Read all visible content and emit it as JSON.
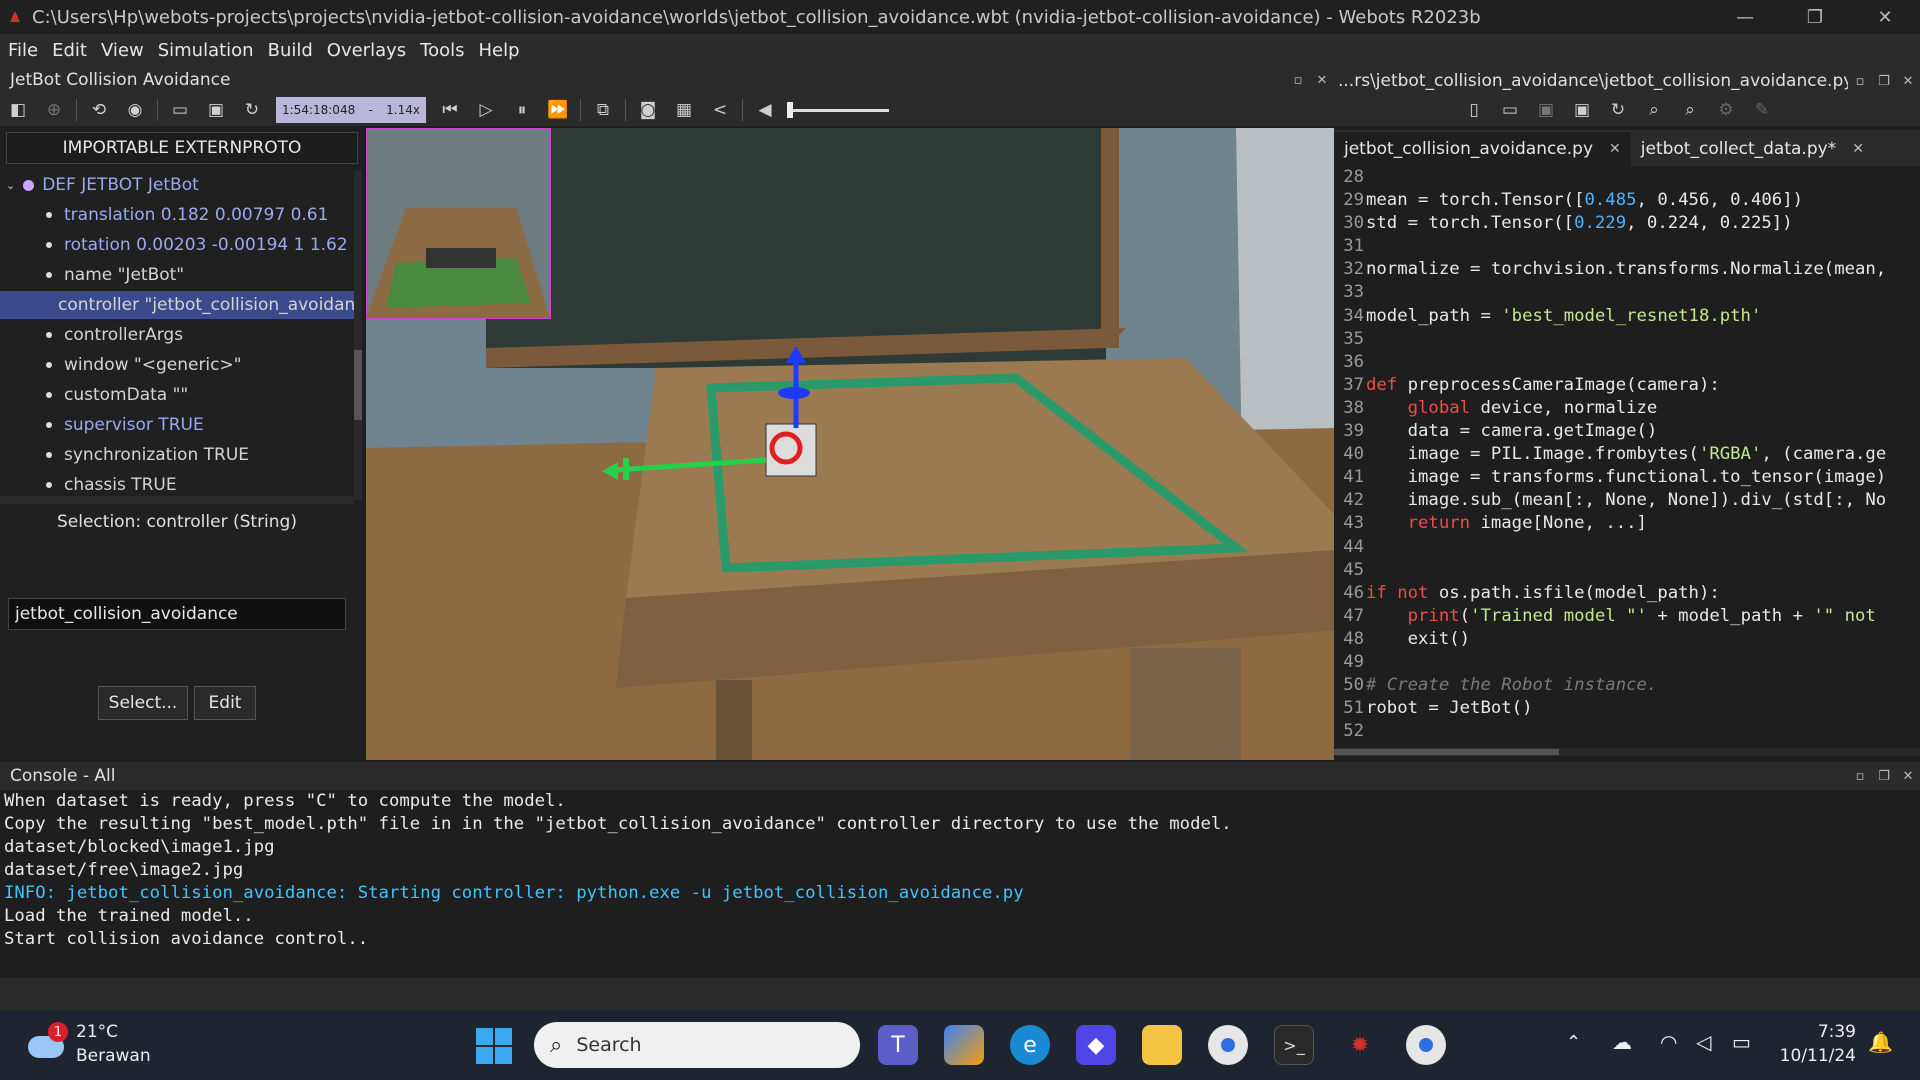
{
  "window": {
    "title": "C:\\Users\\Hp\\webots-projects\\projects\\nvidia-jetbot-collision-avoidance\\worlds\\jetbot_collision_avoidance.wbt (nvidia-jetbot-collision-avoidance) - Webots R2023b",
    "controls": [
      "—",
      "❐",
      "✕"
    ]
  },
  "menu": [
    "File",
    "Edit",
    "View",
    "Simulation",
    "Build",
    "Overlays",
    "Tools",
    "Help"
  ],
  "scene_panel": {
    "title": "JetBot Collision Avoidance",
    "time": "1:54:18:048",
    "speed_sep": "-",
    "speed": "1.14x",
    "importable_btn": "IMPORTABLE EXTERNPROTO",
    "root_node": "DEF JETBOT JetBot",
    "fields": [
      {
        "text": "translation 0.182 0.00797 0.61",
        "modified": true,
        "selected": false
      },
      {
        "text": "rotation 0.00203 -0.00194 1 1.62",
        "modified": true,
        "selected": false
      },
      {
        "text": "name \"JetBot\"",
        "modified": false,
        "selected": false
      },
      {
        "text": "controller \"jetbot_collision_avoidance\"",
        "modified": false,
        "selected": true
      },
      {
        "text": "controllerArgs",
        "modified": false,
        "selected": false
      },
      {
        "text": "window \"<generic>\"",
        "modified": false,
        "selected": false
      },
      {
        "text": "customData \"\"",
        "modified": false,
        "selected": false
      },
      {
        "text": "supervisor TRUE",
        "modified": true,
        "selected": false
      },
      {
        "text": "synchronization TRUE",
        "modified": false,
        "selected": false
      },
      {
        "text": "chassis TRUE",
        "modified": false,
        "selected": false
      }
    ],
    "selection_label": "Selection: controller (String)",
    "controller_value": "jetbot_collision_avoidance",
    "select_btn": "Select...",
    "edit_btn": "Edit"
  },
  "editor": {
    "path": "...rs\\jetbot_collision_avoidance\\jetbot_collision_avoidance.py",
    "tabs": [
      {
        "label": "jetbot_collision_avoidance.py",
        "active": true
      },
      {
        "label": "jetbot_collect_data.py*",
        "active": false
      }
    ],
    "lines": [
      {
        "n": "28",
        "html": ""
      },
      {
        "n": "29",
        "html": "mean = torch.Tensor([<span class=\"num\">0.485</span>, 0.456, 0.406])"
      },
      {
        "n": "30",
        "html": "std = torch.Tensor([<span class=\"num\">0.229</span>, 0.224, 0.225])"
      },
      {
        "n": "31",
        "html": ""
      },
      {
        "n": "32",
        "html": "normalize = torchvision.transforms.Normalize(mean,"
      },
      {
        "n": "33",
        "html": ""
      },
      {
        "n": "34",
        "html": "model_path = <span class=\"st\">'best_model_resnet18.pth'</span>"
      },
      {
        "n": "35",
        "html": ""
      },
      {
        "n": "36",
        "html": ""
      },
      {
        "n": "37",
        "html": "<span class=\"kw\">def</span> preprocessCameraImage(camera):"
      },
      {
        "n": "38",
        "html": "    <span class=\"kw\">global</span> device, normalize"
      },
      {
        "n": "39",
        "html": "    data = camera.getImage()"
      },
      {
        "n": "40",
        "html": "    image = PIL.Image.frombytes(<span class=\"st\">'RGBA'</span>, (camera.ge"
      },
      {
        "n": "41",
        "html": "    image = transforms.functional.to_tensor(image)"
      },
      {
        "n": "42",
        "html": "    image.sub_(mean[:, None, None]).div_(std[:, No"
      },
      {
        "n": "43",
        "html": "    <span class=\"kw\">return</span> image[None, ...]"
      },
      {
        "n": "44",
        "html": ""
      },
      {
        "n": "45",
        "html": ""
      },
      {
        "n": "46",
        "html": "<span class=\"kw\">if not</span> os.path.isfile(model_path):"
      },
      {
        "n": "47",
        "html": "    <span class=\"kw\">print</span>(<span class=\"st\">'Trained model \"'</span> + model_path + <span class=\"st\">'\" not</span>"
      },
      {
        "n": "48",
        "html": "    exit()"
      },
      {
        "n": "49",
        "html": ""
      },
      {
        "n": "50",
        "html": "<span class=\"cm\"># Create the Robot instance.</span>"
      },
      {
        "n": "51",
        "html": "robot = JetBot()"
      },
      {
        "n": "52",
        "html": ""
      }
    ]
  },
  "console": {
    "title": "Console - All",
    "lines": [
      {
        "text": "When dataset is ready, press \"C\" to compute the model.",
        "info": false
      },
      {
        "text": "Copy the resulting \"best_model.pth\" file in in the \"jetbot_collision_avoidance\" controller directory to use the model.",
        "info": false
      },
      {
        "text": "dataset/blocked\\image1.jpg",
        "info": false
      },
      {
        "text": "dataset/free\\image2.jpg",
        "info": false
      },
      {
        "text": "INFO: jetbot_collision_avoidance: Starting controller: python.exe -u jetbot_collision_avoidance.py",
        "info": true
      },
      {
        "text": "Load the trained model..",
        "info": false
      },
      {
        "text": "Start collision avoidance control..",
        "info": false
      }
    ]
  },
  "taskbar": {
    "weather_temp": "21°C",
    "weather_desc": "Berawan",
    "weather_badge": "1",
    "search_placeholder": "Search",
    "time": "7:39",
    "date": "10/11/24"
  },
  "colors": {
    "selection": "#3b4a8c",
    "modified_field": "#9aa9f0",
    "info_text": "#40c4ff",
    "time_box": "#b9b6d9"
  }
}
